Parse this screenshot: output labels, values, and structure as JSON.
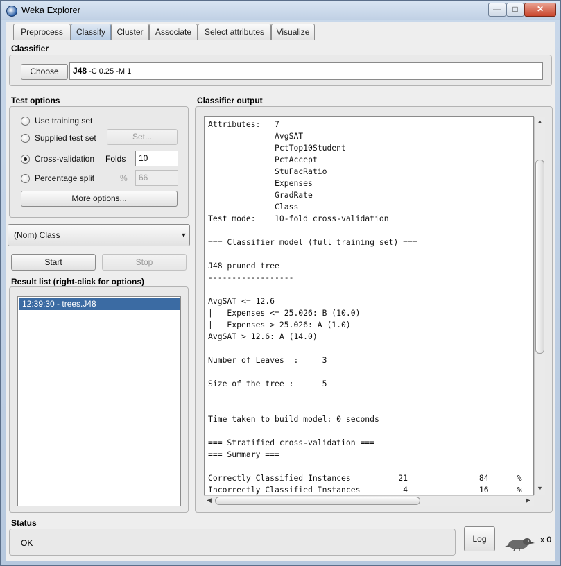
{
  "window": {
    "title": "Weka Explorer",
    "min_glyph": "—",
    "max_glyph": "□",
    "close_glyph": "✕"
  },
  "tabs": [
    "Preprocess",
    "Classify",
    "Cluster",
    "Associate",
    "Select attributes",
    "Visualize"
  ],
  "active_tab": "Classify",
  "classifier": {
    "section_title": "Classifier",
    "choose_label": "Choose",
    "name": "J48",
    "options": " -C 0.25 -M 1"
  },
  "test_options": {
    "section_title": "Test options",
    "radio_training": "Use training set",
    "radio_supplied": "Supplied test set",
    "set_button": "Set...",
    "radio_cv": "Cross-validation",
    "folds_label": "Folds",
    "folds_value": "10",
    "radio_split": "Percentage split",
    "percent_symbol": "%",
    "split_value": "66",
    "more_options": "More options...",
    "selected": "Cross-validation"
  },
  "class_select": {
    "value": "(Nom) Class",
    "arrow": "▼"
  },
  "actions": {
    "start": "Start",
    "stop": "Stop"
  },
  "result_list": {
    "section_title": "Result list (right-click for options)",
    "items": [
      "12:39:30 - trees.J48"
    ]
  },
  "output": {
    "section_title": "Classifier output",
    "lines": [
      "Attributes:   7",
      "              AvgSAT",
      "              PctTop10Student",
      "              PctAccept",
      "              StuFacRatio",
      "              Expenses",
      "              GradRate",
      "              Class",
      "Test mode:    10-fold cross-validation",
      "",
      "=== Classifier model (full training set) ===",
      "",
      "J48 pruned tree",
      "------------------",
      "",
      "AvgSAT <= 12.6",
      "|   Expenses <= 25.026: B (10.0)",
      "|   Expenses > 25.026: A (1.0)",
      "AvgSAT > 12.6: A (14.0)",
      "",
      "Number of Leaves  :     3",
      "",
      "Size of the tree :      5",
      "",
      "",
      "Time taken to build model: 0 seconds",
      "",
      "=== Stratified cross-validation ===",
      "=== Summary ===",
      "",
      "Correctly Classified Instances          21               84      %",
      "Incorrectly Classified Instances         4               16      %"
    ]
  },
  "status": {
    "section_title": "Status",
    "text": "OK",
    "log_button": "Log",
    "task_count": "x 0"
  },
  "colors": {
    "selection": "#3b6ba3",
    "active_tab": "#b9cde4"
  }
}
